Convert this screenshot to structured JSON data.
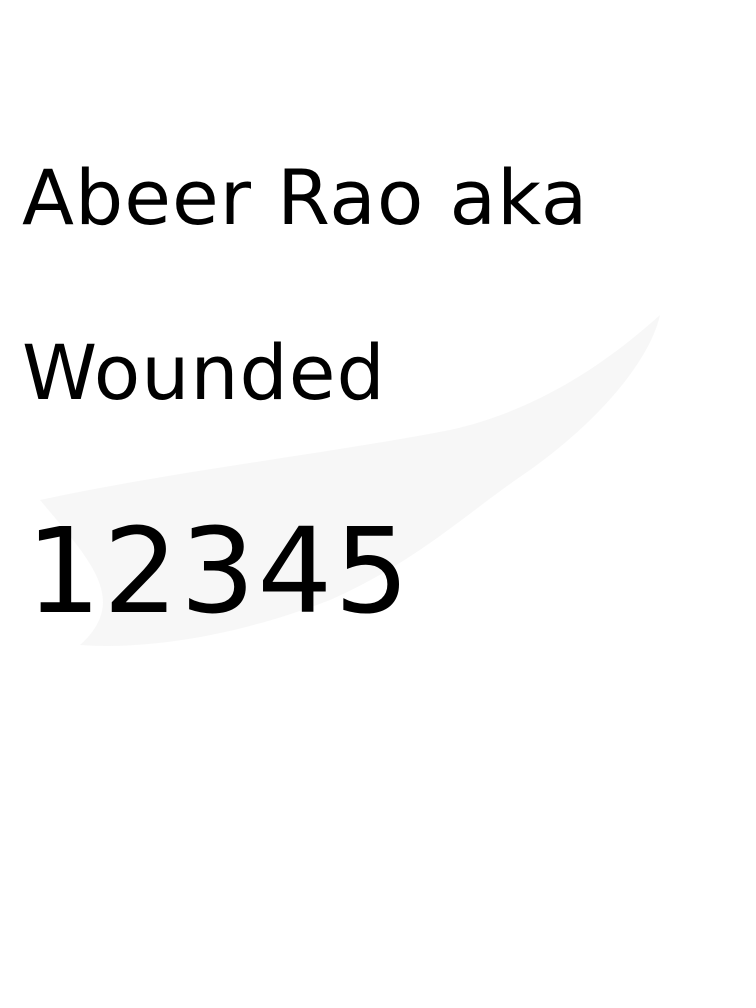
{
  "document": {
    "lines": [
      "Abeer Rao aka",
      "Wounded",
      "12345"
    ]
  },
  "colors": {
    "background": "#ffffff",
    "text": "#000000",
    "smudge": "#f4f4f4"
  }
}
